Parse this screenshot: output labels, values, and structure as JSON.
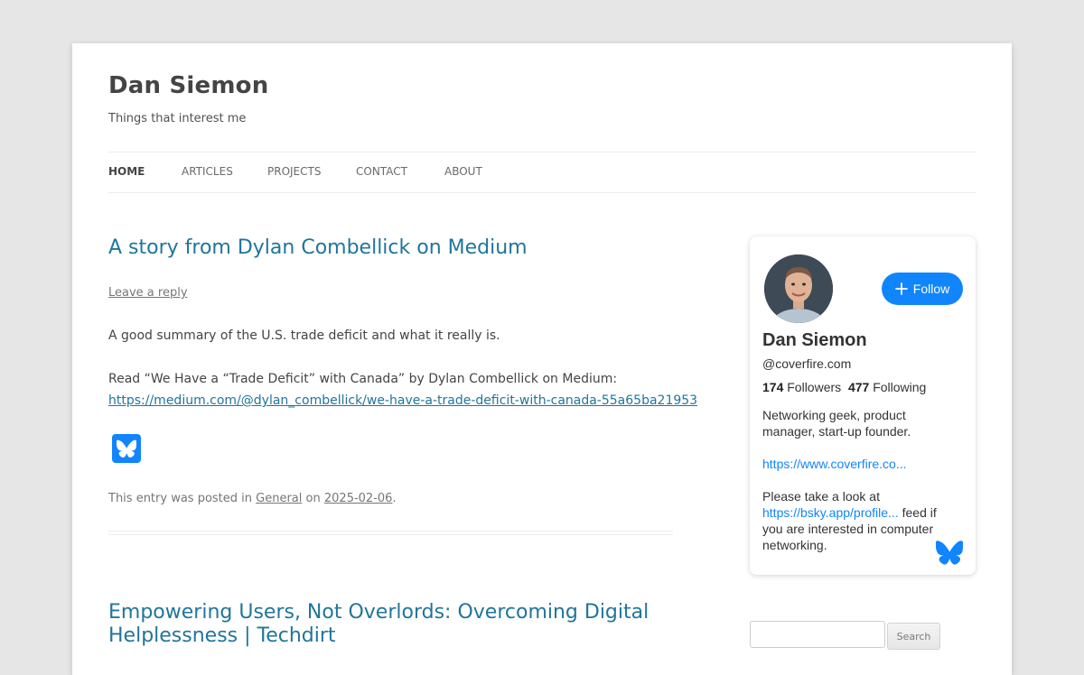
{
  "site": {
    "title": "Dan Siemon",
    "description": "Things that interest me"
  },
  "nav": {
    "items": [
      {
        "label": "HOME",
        "current": true
      },
      {
        "label": "ARTICLES"
      },
      {
        "label": "PROJECTS"
      },
      {
        "label": "CONTACT"
      },
      {
        "label": "ABOUT"
      }
    ]
  },
  "post1": {
    "title": "A story from Dylan Combellick on Medium",
    "leave_reply": "Leave a reply",
    "summary": "A good summary of the U.S. trade deficit and what it really is.",
    "read_line": "Read “We Have a “Trade Deficit” with Canada” by Dylan Combellick on Medium:",
    "link": "https://medium.com/@dylan_combellick/we-have-a-trade-deficit-with-canada-55a65ba21953",
    "meta_prefix": "This entry was posted in",
    "category": "General",
    "meta_on": "on",
    "date": "2025-02-06",
    "meta_end": "."
  },
  "post2": {
    "title_line1": "Empowering Users, Not Overlords: Overcoming Digital",
    "title_line2": "Helplessness | Techdirt"
  },
  "profile_card": {
    "name": "Dan Siemon",
    "handle": "@coverfire.com",
    "followers_count": "174",
    "followers_label": "Followers",
    "following_count": "477",
    "following_label": "Following",
    "follow_label": "Follow",
    "bio_line1": "Networking geek, product manager, start-up founder.",
    "bio_link": "https://www.coverfire.co...",
    "bio_line2_prefix": "Please take a look at",
    "bio_link2": "https://bsky.app/profile...",
    "bio_line2_suffix": "feed if you are interested in computer networking."
  },
  "search": {
    "button_label": "Search",
    "placeholder": ""
  },
  "colors": {
    "link": "#21759b",
    "bluesky": "#1185fe",
    "background": "#e6e6e6"
  },
  "icons": [
    "butterfly-icon",
    "plus-icon",
    "avatar-photo"
  ]
}
